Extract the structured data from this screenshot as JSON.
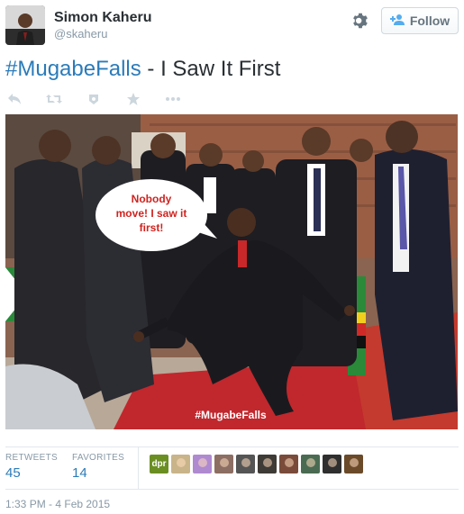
{
  "user": {
    "display_name": "Simon Kaheru",
    "handle": "@skaheru"
  },
  "follow_button": {
    "label": "Follow"
  },
  "tweet": {
    "hashtag": "#MugabeFalls",
    "text": " - I Saw It First"
  },
  "photo": {
    "speech_bubble_lines": [
      "Nobody",
      "move! I saw it",
      "first!"
    ],
    "watermark": "#MugabeFalls"
  },
  "stats": {
    "retweets_label": "RETWEETS",
    "retweets_value": "45",
    "favorites_label": "FAVORITES",
    "favorites_value": "14"
  },
  "favoriters": [
    {
      "name": "dpr",
      "color": "#6b8e23"
    },
    {
      "name": "avatar-2",
      "color": "#c9b48a"
    },
    {
      "name": "avatar-3",
      "color": "#b08ad0"
    },
    {
      "name": "avatar-4",
      "color": "#8d6e63"
    },
    {
      "name": "avatar-5",
      "color": "#555555"
    },
    {
      "name": "avatar-6",
      "color": "#3e3a36"
    },
    {
      "name": "avatar-7",
      "color": "#7a4b3a"
    },
    {
      "name": "avatar-8",
      "color": "#4a6b52"
    },
    {
      "name": "avatar-9",
      "color": "#2f2f2f"
    },
    {
      "name": "avatar-10",
      "color": "#6b4a2a"
    }
  ],
  "timestamp": "1:33 PM - 4 Feb 2015",
  "colors": {
    "link": "#2b7bb9",
    "muted": "#8899a6",
    "text": "#292f33"
  },
  "icons": [
    "gear-icon",
    "add-user-icon",
    "reply-icon",
    "retweet-icon",
    "favorite-icon",
    "star-icon",
    "more-icon"
  ]
}
